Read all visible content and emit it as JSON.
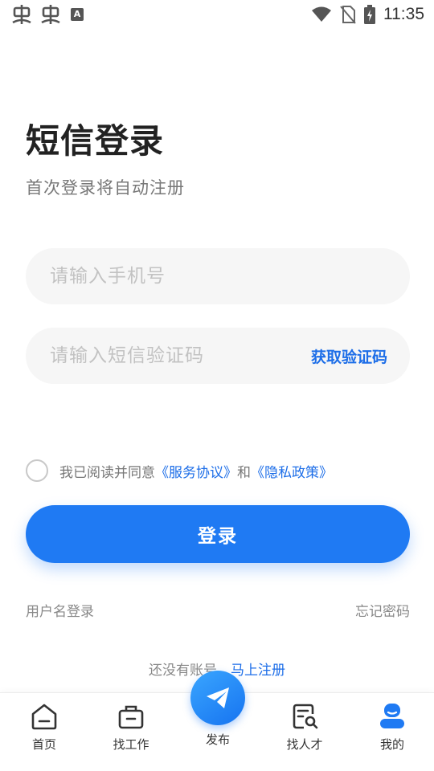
{
  "status_bar": {
    "time": "11:35",
    "left_icons": [
      "bug-icon",
      "bug-icon",
      "text-a-icon"
    ],
    "right_icons": [
      "wifi-icon",
      "no-sim-icon",
      "battery-charging-icon"
    ]
  },
  "login": {
    "title": "短信登录",
    "subtitle": "首次登录将自动注册",
    "phone_placeholder": "请输入手机号",
    "code_placeholder": "请输入短信验证码",
    "get_code_label": "获取验证码",
    "agree_prefix": "我已阅读并同意",
    "service_agreement": "《服务协议》",
    "agree_and": "和",
    "privacy_policy": "《隐私政策》",
    "login_button": "登录",
    "username_login": "用户名登录",
    "forgot_password": "忘记密码",
    "no_account": "还没有账号，",
    "register_now": "马上注册"
  },
  "bottom_nav": {
    "items": [
      {
        "label": "首页",
        "icon": "home-icon"
      },
      {
        "label": "找工作",
        "icon": "briefcase-icon"
      },
      {
        "label": "发布",
        "icon": "paper-plane-icon"
      },
      {
        "label": "找人才",
        "icon": "resume-search-icon"
      },
      {
        "label": "我的",
        "icon": "user-icon"
      }
    ]
  },
  "colors": {
    "accent": "#1f7af3",
    "link": "#1d6ee8",
    "input_bg": "#f6f6f6"
  }
}
